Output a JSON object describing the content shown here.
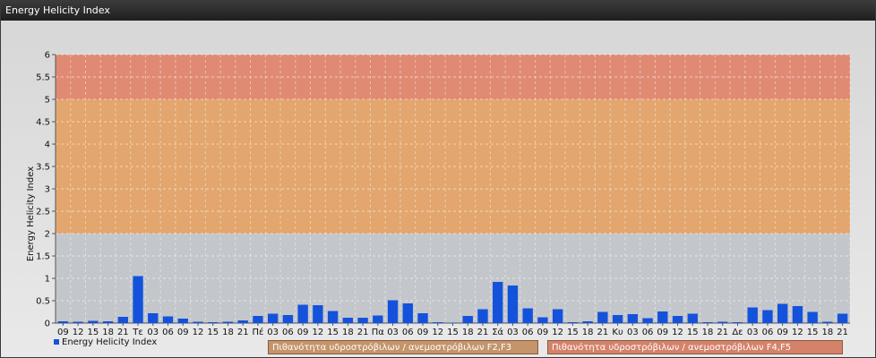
{
  "window": {
    "title": "Energy Helicity Index"
  },
  "chart_data": {
    "type": "bar",
    "ylabel": "Energy Helicity Index",
    "ylim": [
      0,
      6
    ],
    "yticks": [
      0,
      0.5,
      1,
      1.5,
      2,
      2.5,
      3,
      3.5,
      4,
      4.5,
      5,
      5.5,
      6
    ],
    "grid": true,
    "bands": [
      {
        "from": 0,
        "to": 2,
        "color": "#c3c6cb"
      },
      {
        "from": 2,
        "to": 5,
        "color": "#e2a66e"
      },
      {
        "from": 5,
        "to": 6,
        "color": "#e08a74"
      }
    ],
    "categories": [
      "09",
      "12",
      "15",
      "18",
      "21",
      "Τε",
      "03",
      "06",
      "09",
      "12",
      "15",
      "18",
      "21",
      "Πέ",
      "03",
      "06",
      "09",
      "12",
      "15",
      "18",
      "21",
      "Πα",
      "03",
      "06",
      "09",
      "12",
      "15",
      "18",
      "21",
      "Σά",
      "03",
      "06",
      "09",
      "12",
      "15",
      "18",
      "21",
      "Κυ",
      "03",
      "06",
      "09",
      "12",
      "15",
      "18",
      "21",
      "Δε",
      "03",
      "06",
      "09",
      "12",
      "15",
      "18",
      "21"
    ],
    "series": [
      {
        "name": "Energy Helicity Index",
        "color": "#1452dc",
        "values": [
          0.04,
          0.03,
          0.05,
          0.04,
          0.14,
          1.05,
          0.22,
          0.15,
          0.1,
          0.03,
          0.02,
          0.03,
          0.06,
          0.16,
          0.21,
          0.18,
          0.41,
          0.4,
          0.27,
          0.12,
          0.12,
          0.17,
          0.51,
          0.44,
          0.22,
          0.02,
          0.01,
          0.16,
          0.31,
          0.92,
          0.84,
          0.33,
          0.13,
          0.31,
          0.02,
          0.04,
          0.25,
          0.18,
          0.2,
          0.11,
          0.26,
          0.16,
          0.21,
          0.02,
          0.03,
          0.02,
          0.35,
          0.29,
          0.43,
          0.38,
          0.25,
          0.03,
          0.21
        ]
      }
    ]
  },
  "legend": {
    "series_label": "Energy Helicity Index",
    "band1_label": "Πιθανότητα υδροστρόβιλων / ανεμοστρόβιλων F2,F3",
    "band2_label": "Πιθανότητα υδροστρόβιλων / ανεμοστρόβιλων F4,F5",
    "band1_color": "#c4946a",
    "band2_color": "#d4826a"
  }
}
